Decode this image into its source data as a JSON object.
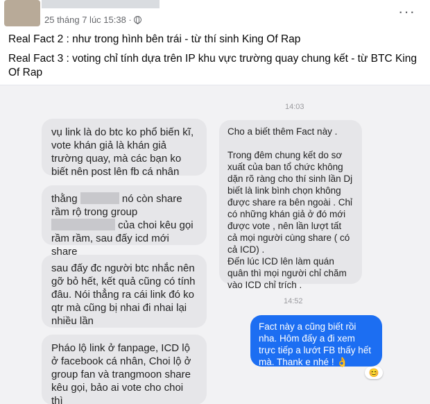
{
  "post": {
    "date": "25 tháng 7 lúc 15:38 ·",
    "globe_icon": "globe-icon",
    "more_icon": "more-options-icon",
    "more_label": "···",
    "line1": "Real Fact 2 : như trong hình bên trái - từ thí sinh King Of Rap",
    "line2": "Real Fact 3 : voting chỉ tính dựa trên IP khu vực trường quay chung kết - từ BTC King Of Rap"
  },
  "chat": {
    "time1": "14:03",
    "time2": "14:52",
    "left_messages": [
      "vụ link là do btc ko phổ biến kĩ, vote khán giả là khán giả trường quay, mà các bạn ko biết nên post lên fb cá nhân",
      "sau đấy đc người btc nhắc nên gỡ bỏ hết, kết quả cũng có tính đâu. Nói thẳng ra cái link đó ko qtr mà cũng bị nhai đi nhai lại nhiều lần",
      "Pháo lộ link ở fanpage, ICD lộ ở facebook cá nhân, Choi lộ ở group fan và trangmoon share kêu gọi, bảo ai vote cho choi thì"
    ],
    "left_msg2": {
      "part1": "thằng",
      "part2": "nó còn share rầm rộ trong group",
      "part3": "của choi kêu gọi rầm rầm, sau đấy icd mới share"
    },
    "right_message": "Cho a biết thêm Fact này .\n\nTrong đêm chung kết do sơ xuất của ban tổ chức không dặn rõ ràng cho thí sinh lần Dj biết là link bình chọn không được share ra bên ngoài . Chỉ có những khán giả ở đó mới được vote , nên lần lượt tất cả mọi người cùng share ( có cả ICD) .\nĐến lúc ICD lên làm quán quân thì mọi người chỉ chăm vào ICD chỉ trích .",
    "blue_message": "Fact này a cũng biết rồi nha. Hôm đấy a đi xem trực tiếp a lướt FB thấy hết mà. Thank e nhé ! 👌",
    "reaction": "😊"
  }
}
